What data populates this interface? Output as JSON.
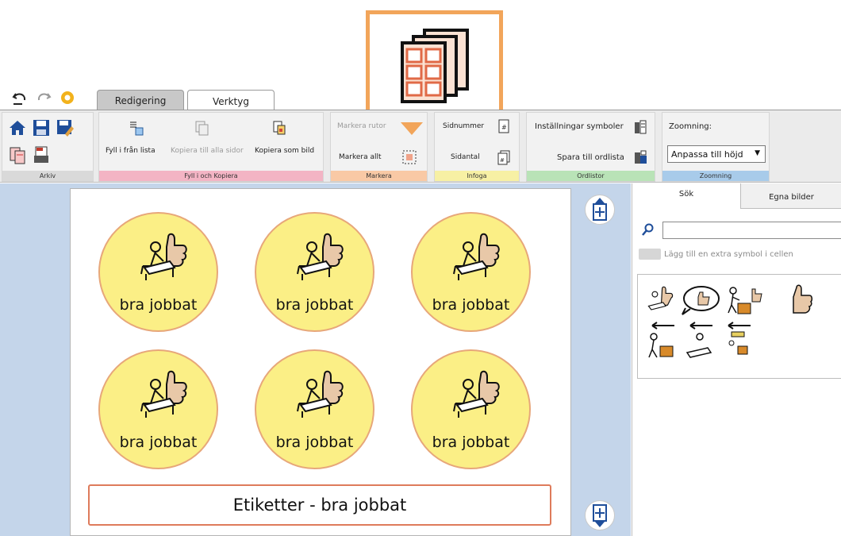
{
  "quick_access": {
    "icons": [
      "undo-icon",
      "redo-icon",
      "settings-icon"
    ]
  },
  "tabs": [
    {
      "label": "Redigering",
      "active": false
    },
    {
      "label": "Verktyg",
      "active": true
    }
  ],
  "ribbon": {
    "groups": {
      "arkiv": "Arkiv",
      "fyll": "Fyll i och Kopiera",
      "markera": "Markera",
      "infoga": "Infoga",
      "ordlistor": "Ordlistor",
      "zoomning": "Zoomning"
    },
    "buttons": {
      "fyll_fran_lista": "Fyll i från lista",
      "kopiera_alla_sidor": "Kopiera till alla sidor",
      "kopiera_som_bild": "Kopiera som bild",
      "markera_rutor": "Markera rutor",
      "markera_allt": "Markera allt",
      "sidnummer": "Sidnummer",
      "sidantal": "Sidantal",
      "installningar_symboler": "Inställningar symboler",
      "spara_ordlista": "Spara till ordlista",
      "zoomning_label": "Zoomning:",
      "zoom_value": "Anpassa till höjd"
    }
  },
  "stickers": [
    {
      "label": "bra jobbat"
    },
    {
      "label": "bra jobbat"
    },
    {
      "label": "bra jobbat"
    },
    {
      "label": "bra jobbat"
    },
    {
      "label": "bra jobbat"
    },
    {
      "label": "bra jobbat"
    }
  ],
  "page_title": "Etiketter - bra jobbat",
  "panel": {
    "tab_search": "Sök",
    "tab_own": "Egna bilder",
    "search_value": "",
    "extra_symbol": "Lägg till en extra symbol i cellen"
  },
  "colors": {
    "sticker_fill": "#fbef86",
    "sticker_border": "#e7a77a",
    "callout_border": "#f2a55a",
    "workspace_bg": "#c4d5ea"
  }
}
